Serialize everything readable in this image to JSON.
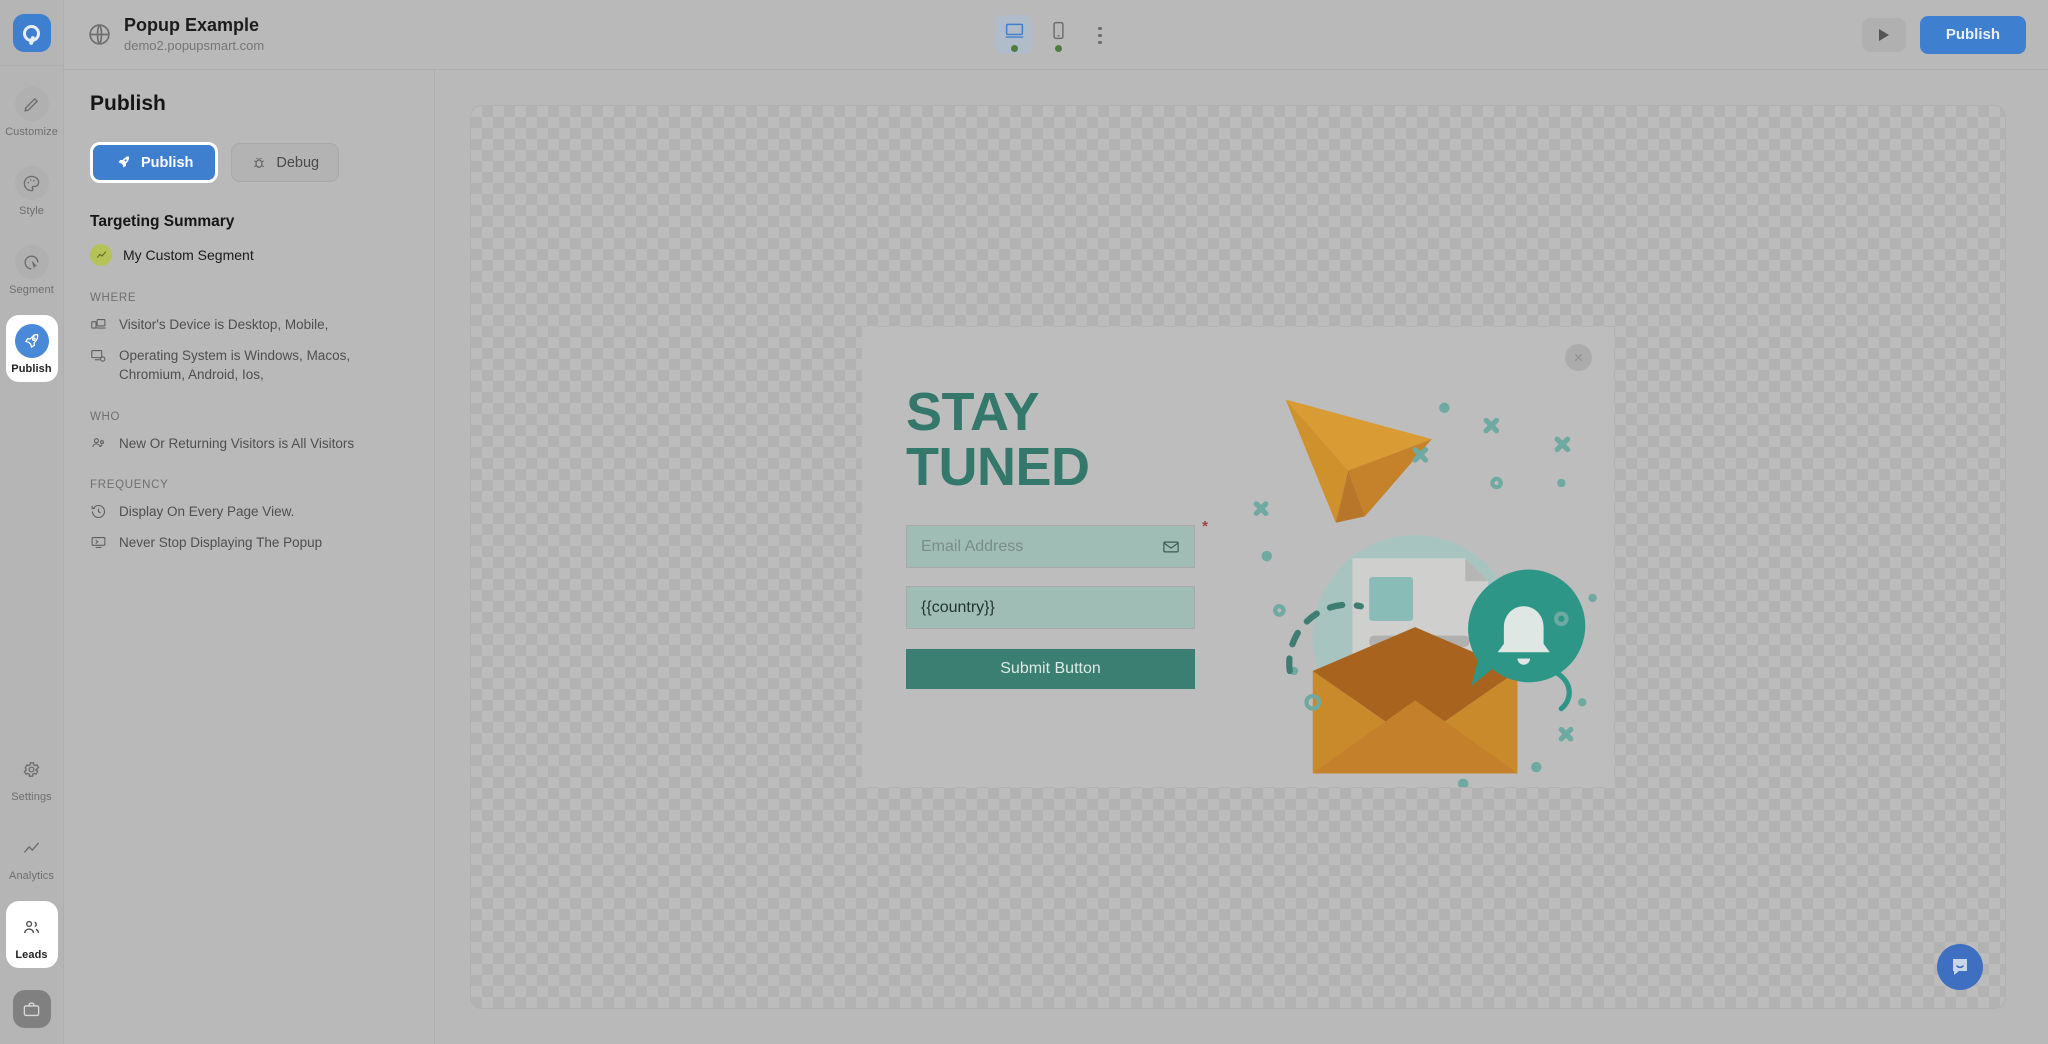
{
  "app": {
    "logo_icon": "popupsmart-logo-icon",
    "project_title": "Popup Example",
    "project_url": "demo2.popupsmart.com",
    "globe_icon": "globe-icon"
  },
  "rail": {
    "top_items": [
      {
        "label": "Customize",
        "icon": "pencil-icon",
        "active": false
      },
      {
        "label": "Style",
        "icon": "palette-icon",
        "active": false
      },
      {
        "label": "Segment",
        "icon": "cursor-target-icon",
        "active": false
      },
      {
        "label": "Publish",
        "icon": "rocket-icon",
        "active": true
      }
    ],
    "bottom_items": [
      {
        "label": "Settings",
        "icon": "gear-icon",
        "active": false
      },
      {
        "label": "Analytics",
        "icon": "line-chart-icon",
        "active": false
      },
      {
        "label": "Leads",
        "icon": "people-icon",
        "active": true
      }
    ],
    "briefcase_icon": "briefcase-icon"
  },
  "toolbar": {
    "devices": [
      {
        "name": "desktop",
        "icon": "desktop-icon",
        "active": true,
        "status_dot": "#4e7c3e"
      },
      {
        "name": "mobile",
        "icon": "mobile-icon",
        "active": false,
        "status_dot": "#4e7c3e"
      }
    ],
    "kebab_icon": "more-vertical-icon",
    "preview_icon": "play-icon",
    "publish_label": "Publish"
  },
  "panel": {
    "title": "Publish",
    "publish_button": {
      "label": "Publish",
      "icon": "rocket-icon"
    },
    "debug_button": {
      "label": "Debug",
      "icon": "bug-icon"
    },
    "targeting_title": "Targeting Summary",
    "segment": {
      "name": "My Custom Segment",
      "icon": "trend-line-icon",
      "badge_color": "#b5c257"
    },
    "groups": [
      {
        "label": "WHERE",
        "rules": [
          {
            "icon": "device-icon",
            "text": "Visitor's Device is Desktop, Mobile,"
          },
          {
            "icon": "os-monitor-icon",
            "text": "Operating System is Windows, Macos, Chromium, Android, Ios,"
          }
        ]
      },
      {
        "label": "WHO",
        "rules": [
          {
            "icon": "visitors-icon",
            "text": "New Or Returning Visitors is All Visitors"
          }
        ]
      },
      {
        "label": "FREQUENCY",
        "rules": [
          {
            "icon": "history-icon",
            "text": "Display On Every Page View."
          },
          {
            "icon": "monitor-stop-icon",
            "text": "Never Stop Displaying The Popup"
          }
        ]
      }
    ]
  },
  "popup": {
    "headline_line1": "STAY",
    "headline_line2": "TUNED",
    "headline_color": "#34786c",
    "email_field": {
      "placeholder": "Email Address",
      "value": "",
      "icon": "envelope-icon",
      "required_marker": "*"
    },
    "country_field": {
      "value": "{{country}}",
      "placeholder": ""
    },
    "submit_label": "Submit Button",
    "submit_color": "#3a7f71",
    "close_icon": "close-x-icon",
    "illustration": "newsletter-envelope-bell-illustration"
  },
  "chat": {
    "icon": "chat-bubble-icon",
    "color": "#3f6fc0"
  }
}
